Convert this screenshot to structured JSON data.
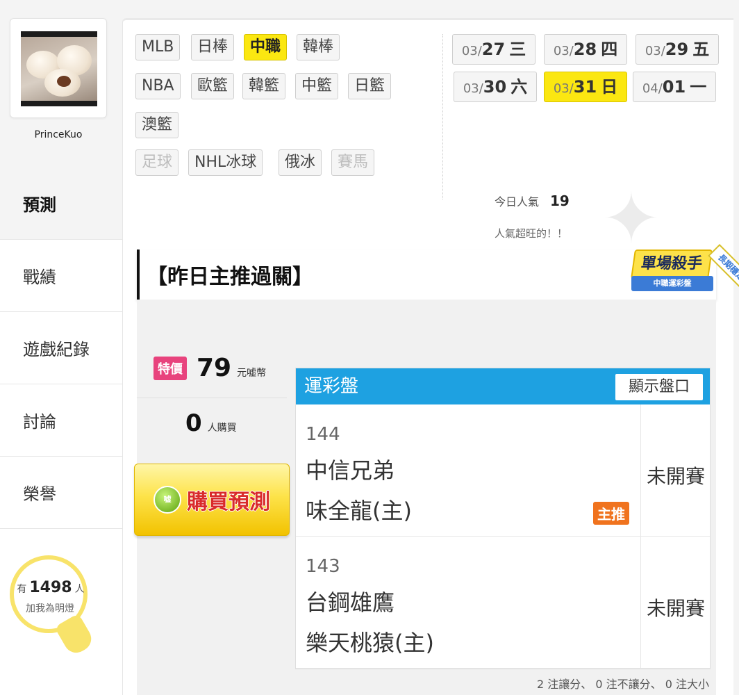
{
  "user": {
    "name": "PrinceKuo"
  },
  "nav": [
    {
      "label": "預測",
      "active": true
    },
    {
      "label": "戰績",
      "active": false
    },
    {
      "label": "遊戲紀錄",
      "active": false
    },
    {
      "label": "討論",
      "active": false
    },
    {
      "label": "榮譽",
      "active": false
    }
  ],
  "fans": {
    "prefix": "有",
    "count": "1498",
    "suffix": "人",
    "line2": "加我為明燈"
  },
  "sports": [
    {
      "label": "MLB",
      "state": "normal"
    },
    {
      "label": "日棒",
      "state": "normal"
    },
    {
      "label": "中職",
      "state": "active"
    },
    {
      "label": "韓棒",
      "state": "normal"
    },
    {
      "label": "NBA",
      "state": "normal"
    },
    {
      "label": "歐籃",
      "state": "normal"
    },
    {
      "label": "韓籃",
      "state": "normal"
    },
    {
      "label": "中籃",
      "state": "normal"
    },
    {
      "label": "日籃",
      "state": "normal"
    },
    {
      "label": "澳籃",
      "state": "normal"
    },
    {
      "label": "足球",
      "state": "disabled"
    },
    {
      "label": "NHL冰球",
      "state": "normal"
    },
    {
      "label": "俄冰",
      "state": "normal"
    },
    {
      "label": "賽馬",
      "state": "disabled"
    }
  ],
  "dates": [
    {
      "month": "03/",
      "day": "27",
      "weekday": "三",
      "active": false
    },
    {
      "month": "03/",
      "day": "28",
      "weekday": "四",
      "active": false
    },
    {
      "month": "03/",
      "day": "29",
      "weekday": "五",
      "active": false
    },
    {
      "month": "03/",
      "day": "30",
      "weekday": "六",
      "active": false
    },
    {
      "month": "03/",
      "day": "31",
      "weekday": "日",
      "active": true
    },
    {
      "month": "04/",
      "day": "01",
      "weekday": "一",
      "active": false
    }
  ],
  "popularity": {
    "label": "今日人氣",
    "value": "19",
    "note": "人氣超旺的！！"
  },
  "yesterday": {
    "title": "【昨日主推過關】"
  },
  "badge": {
    "main": "單場殺手",
    "sub": "中職運彩盤",
    "ribbon": "長期穩定"
  },
  "price": {
    "tag": "特價",
    "value": "79",
    "unit": "元嘘幣"
  },
  "buyers": {
    "count": "0",
    "unit": "人購買"
  },
  "buy_button": {
    "label": "購買預測",
    "coin": "嘘"
  },
  "odds": {
    "title": "運彩盤",
    "show_label": "顯示盤口",
    "games": [
      {
        "no": "144",
        "away": "中信兄弟",
        "home": "味全龍(主)",
        "status": "未開賽",
        "pick": "主推"
      },
      {
        "no": "143",
        "away": "台鋼雄鷹",
        "home": "樂天桃猿(主)",
        "status": "未開賽",
        "pick": ""
      }
    ],
    "summary": "2 注讓分、 0 注不讓分、 0 注大小"
  }
}
